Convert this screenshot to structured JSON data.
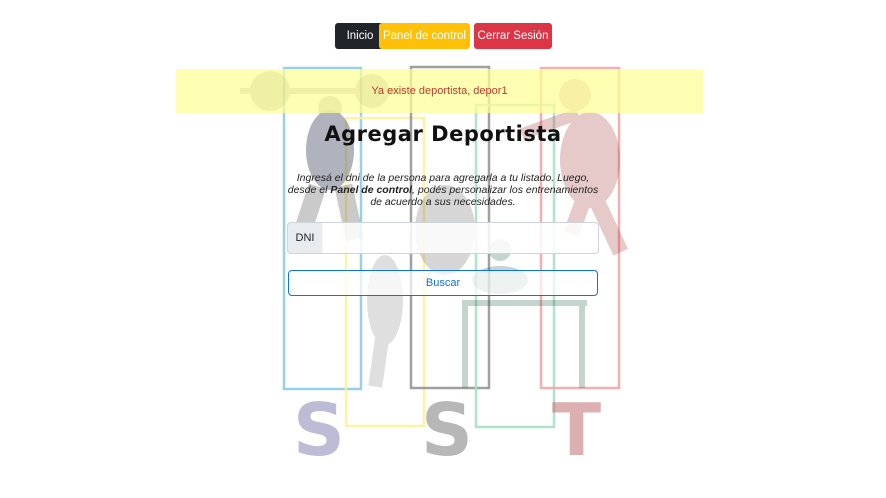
{
  "nav": {
    "home_label": "Inicio",
    "panel_label": "Panel de control",
    "logout_label": "Cerrar Sesión",
    "colors": {
      "home": "#212529",
      "panel": "#ffc107",
      "logout": "#dc3545"
    }
  },
  "alert": {
    "message": "Ya existe deportista, depor1"
  },
  "page": {
    "title": "Agregar Deportista",
    "desc_part1": "Ingresá el dni de la persona para agregarla a tu listado. Luego, desde el ",
    "desc_bold": "Panel de control",
    "desc_part2": ", podés personalizar los entrenamientos de acuerdo a sus necesidades."
  },
  "form": {
    "dni_label": "DNI",
    "dni_value": "",
    "search_label": "Buscar"
  },
  "background": {
    "logo_letters": [
      "S",
      "S",
      "T"
    ],
    "colors": [
      "#3fa0d0",
      "#f5e35a",
      "#555555",
      "#4fc08d",
      "#e85a5a"
    ]
  }
}
